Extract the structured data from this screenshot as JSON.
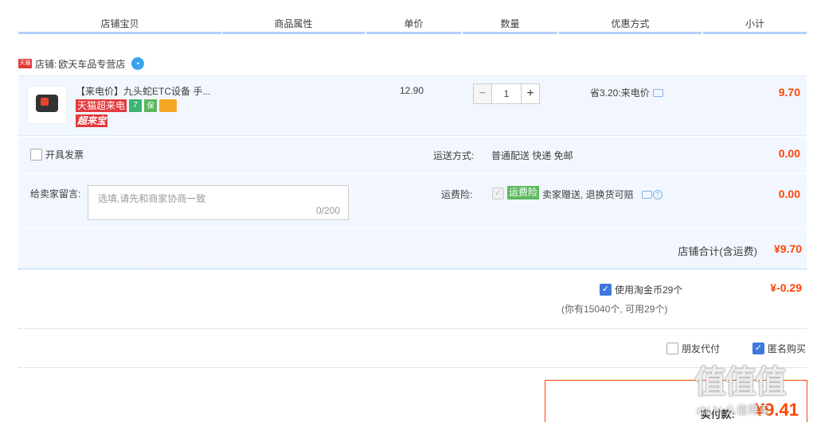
{
  "header": {
    "cols": [
      "店铺宝贝",
      "商品属性",
      "单价",
      "数量",
      "优惠方式",
      "小计"
    ]
  },
  "shop": {
    "badge": "天猫",
    "label": "店铺:",
    "name": "欧天车品专营店"
  },
  "item": {
    "title": "【来电价】九头蛇ETC设备 手...",
    "tag_supermarket": "天猫超来电",
    "tag_7": "7",
    "tag_shield": "保",
    "tag_promo": "超来宝",
    "unit_price": "12.90",
    "qty_minus": "−",
    "qty_value": "1",
    "qty_plus": "+",
    "discount": "省3.20:来电价",
    "subtotal": "9.70"
  },
  "options": {
    "invoice_label": "开具发票",
    "ship_label": "运送方式:",
    "ship_value": "普通配送 快递 免邮",
    "ship_fee": "0.00",
    "msg_label": "给卖家留言:",
    "msg_placeholder": "选填,请先和商家协商一致",
    "msg_count": "0/200",
    "ins_label": "运费险:",
    "ins_tag": "运费险",
    "ins_desc": "卖家赠送, 退换货可赔",
    "ins_fee": "0.00"
  },
  "shop_total": {
    "label": "店铺合计(含运费)",
    "amount": "¥9.70"
  },
  "coins": {
    "label": "使用淘金币29个",
    "note": "(你有15040个, 可用29个)",
    "amount": "¥-0.29"
  },
  "extras": {
    "friend_pay": "朋友代付",
    "anonymous": "匿名购买"
  },
  "pay": {
    "label": "实付款:",
    "amount": "¥9.41"
  },
  "watermark": {
    "big": "值值值",
    "small": "zhi.hi 么值得买"
  },
  "colors": {
    "accent_red": "#ff4400",
    "header_line": "#b2d1ff",
    "row_bg": "#f2f7ff",
    "check_blue": "#3f78dd"
  }
}
